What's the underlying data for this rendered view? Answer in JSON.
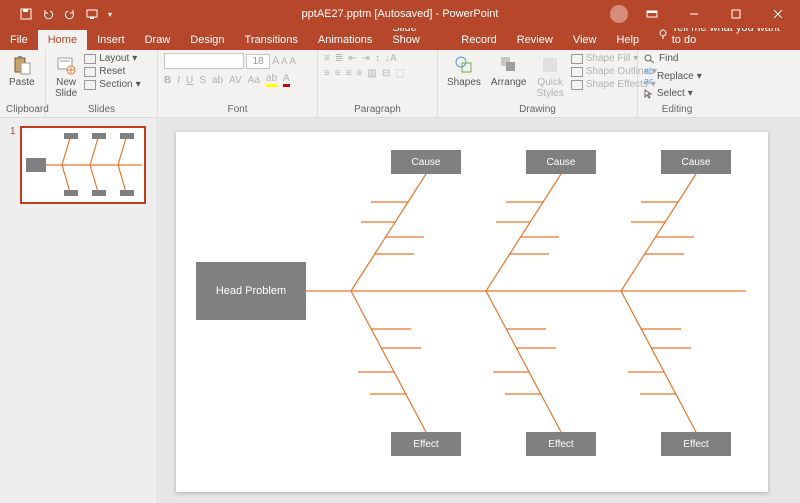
{
  "titlebar": {
    "title": "pptAE27.pptm [Autosaved] - PowerPoint",
    "user": "",
    "qat_dropdown": "▾"
  },
  "tabs": {
    "file": "File",
    "home": "Home",
    "insert": "Insert",
    "draw": "Draw",
    "design": "Design",
    "transitions": "Transitions",
    "animations": "Animations",
    "slideshow": "Slide Show",
    "record": "Record",
    "review": "Review",
    "view": "View",
    "help": "Help",
    "tellme": "Tell me what you want to do"
  },
  "ribbon": {
    "clipboard": {
      "paste": "Paste",
      "label": "Clipboard"
    },
    "slides": {
      "new": "New\nSlide",
      "layout": "Layout",
      "reset": "Reset",
      "section": "Section",
      "label": "Slides"
    },
    "font": {
      "size": "18",
      "label": "Font"
    },
    "paragraph": {
      "label": "Paragraph"
    },
    "drawing": {
      "shapes": "Shapes",
      "arrange": "Arrange",
      "quick": "Quick\nStyles",
      "fill": "Shape Fill",
      "outline": "Shape Outline",
      "effects": "Shape Effects",
      "label": "Drawing"
    },
    "editing": {
      "find": "Find",
      "replace": "Replace",
      "select": "Select",
      "label": "Editing"
    }
  },
  "slidepanel": {
    "num": "1"
  },
  "diagram": {
    "head": "Head Problem",
    "cause": "Cause",
    "effect": "Effect"
  }
}
